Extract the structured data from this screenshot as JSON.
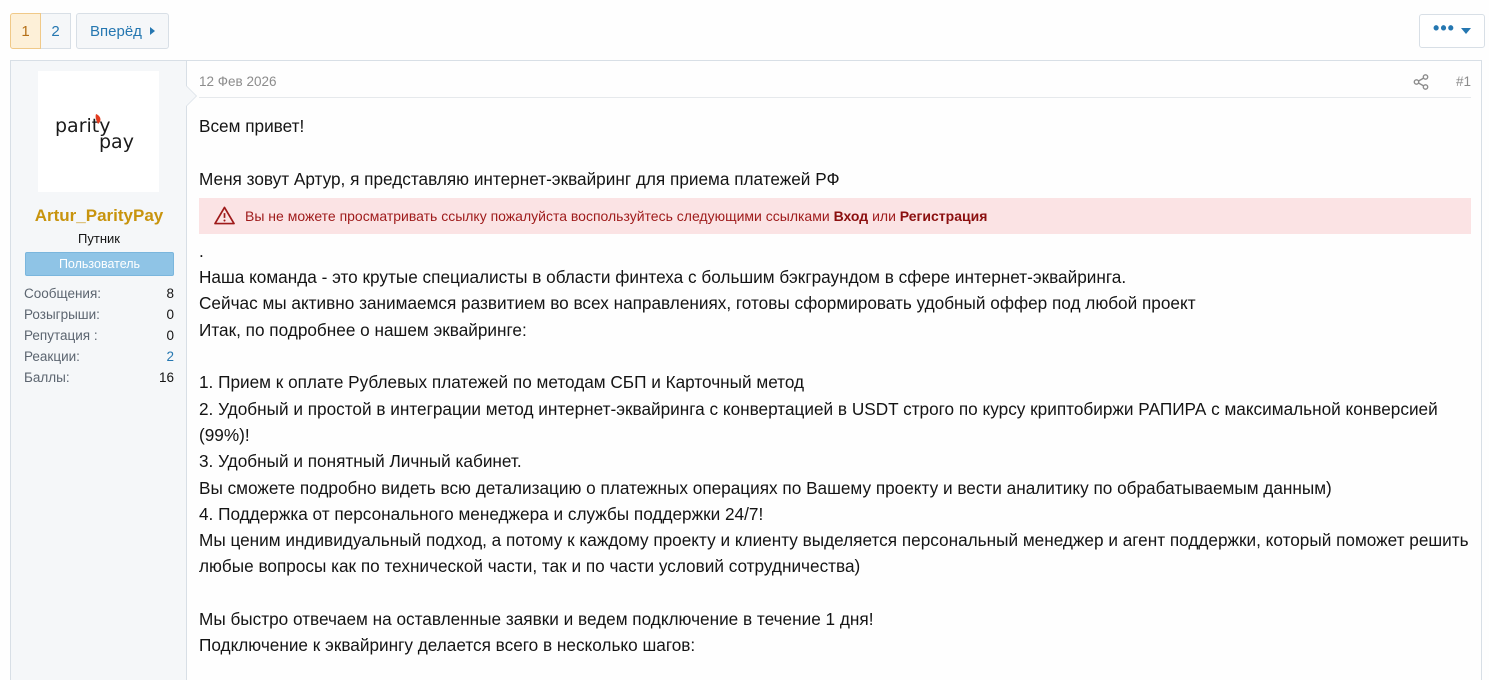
{
  "pagination": {
    "current": "1",
    "pages": [
      "2"
    ],
    "next_label": "Вперёд"
  },
  "menu": {
    "dots": "•••"
  },
  "user": {
    "avatar_text_top": "parity",
    "avatar_text_bottom": "pay",
    "name": "Artur_ParityPay",
    "title": "Путник",
    "banner": "Пользователь",
    "stats": [
      {
        "label": "Сообщения:",
        "value": "8"
      },
      {
        "label": "Розыгрыши:",
        "value": "0"
      },
      {
        "label": "Репутация :",
        "value": "0"
      },
      {
        "label": "Реакции:",
        "value": "2"
      },
      {
        "label": "Баллы:",
        "value": "16"
      }
    ]
  },
  "post": {
    "date": "12 Фев 2026",
    "number": "#1",
    "greeting": "Всем привет!",
    "intro": "Меня зовут Артур, я представляю интернет-эквайринг для приема платежей РФ",
    "notice": {
      "text": "Вы не можете просматривать ссылку пожалуйста воспользуйтесь следующими ссылками",
      "login": "Вход",
      "or": "или",
      "register": "Регистрация"
    },
    "lines": [
      ".",
      "Наша команда - это крутые специалисты в области финтеха с большим бэкграундом в сфере интернет-эквайринга.",
      "Сейчас мы активно занимаемся развитием во всех направлениях, готовы сформировать удобный оффер под любой проект",
      "Итак, по подробнее о нашем эквайринге:",
      "",
      "1. Прием к оплате Рублевых платежей по методам СБП и Карточный метод",
      "2. Удобный и простой в интеграции метод интернет-эквайринга с конвертацией в USDT строго по курсу криптобиржи РАПИРА с максимальной конверсией (99%)!",
      "3. Удобный и понятный Личный кабинет.",
      "Вы сможете подробно видеть всю детализацию о платежных операциях по Вашему проекту и вести аналитику по обрабатываемым данным)",
      "4. Поддержка от персонального менеджера и службы поддержки 24/7!",
      "Мы ценим индивидуальный подход, а потому к каждому проекту и клиенту выделяется персональный менеджер и агент поддержки, который поможет решить любые вопросы как по технической части, так и по части условий сотрудничества)",
      "",
      "Мы быстро отвечаем на оставленные заявки и ведем подключение в течение 1 дня!",
      "Подключение к эквайрингу делается всего в несколько шагов:"
    ]
  },
  "colors": {
    "accent": "#2577b1",
    "username": "#c8940e",
    "banner": "#8fc4e6",
    "notice_bg": "#fbe3e4"
  }
}
